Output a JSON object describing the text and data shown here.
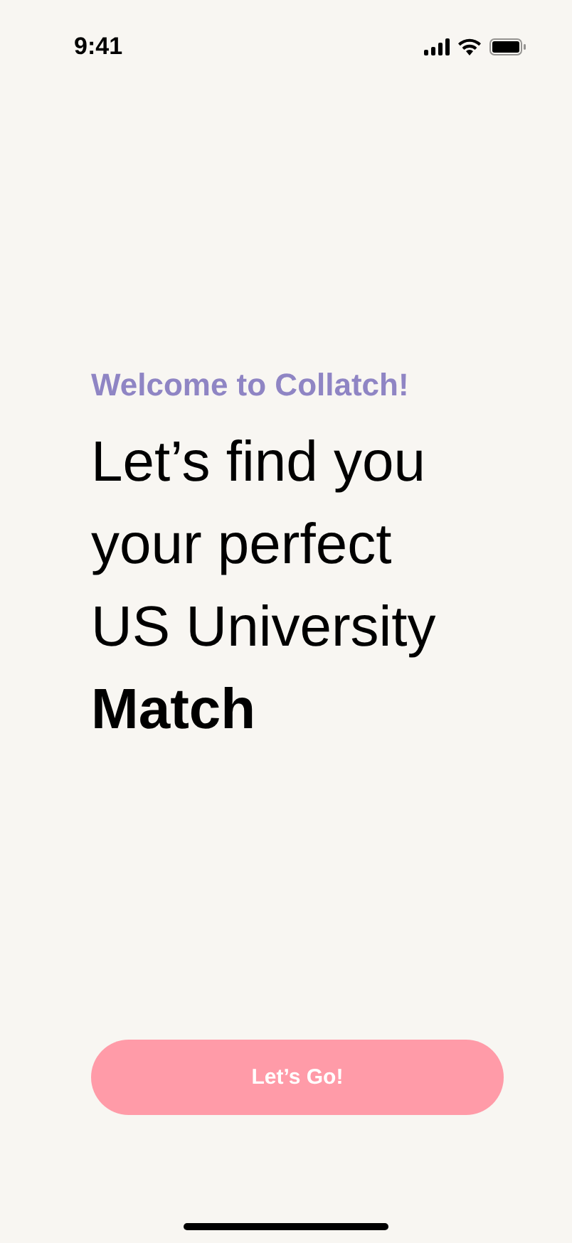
{
  "status_bar": {
    "time": "9:41"
  },
  "welcome": "Welcome to Collatch!",
  "headline": "Let’s find you\nyour perfect\nUS University\n**Match**",
  "button": {
    "label": "Let’s Go!"
  }
}
